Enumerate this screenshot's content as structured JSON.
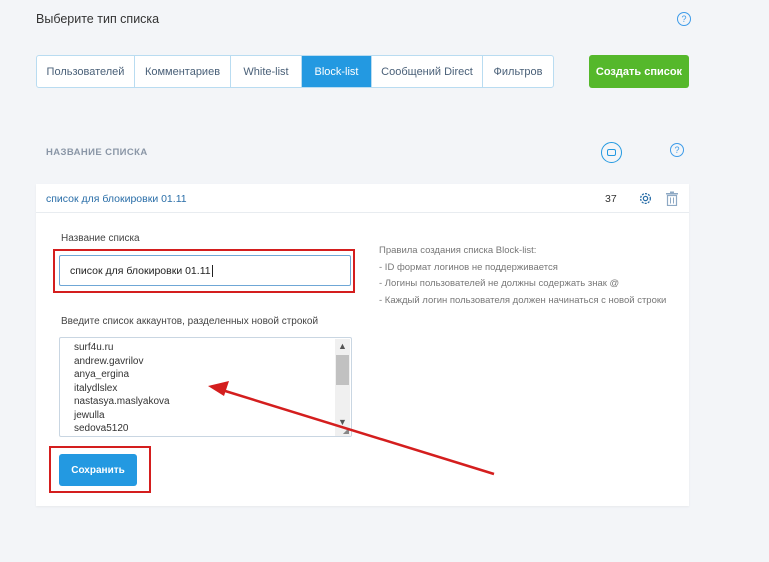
{
  "header": {
    "title": "Выберите тип списка"
  },
  "tabs": [
    {
      "label": "Пользователей",
      "active": false
    },
    {
      "label": "Комментариев",
      "active": false
    },
    {
      "label": "White-list",
      "active": false
    },
    {
      "label": "Block-list",
      "active": true
    },
    {
      "label": "Сообщений Direct",
      "active": false
    },
    {
      "label": "Фильтров",
      "active": false
    }
  ],
  "create_button": {
    "label": "Создать список"
  },
  "section": {
    "title": "НАЗВАНИЕ СПИСКА"
  },
  "list_row": {
    "name": "список для блокировки 01.11",
    "count": "37"
  },
  "form": {
    "name_label": "Название списка",
    "name_value": "список для блокировки 01.11",
    "accounts_label": "Введите список аккаунтов, разделенных новой строкой",
    "accounts": [
      "surf4u.ru",
      "andrew.gavrilov",
      "anya_ergina",
      "italydlslex",
      "nastasya.maslyakova",
      "jewulla",
      "sedova5120"
    ],
    "save_label": "Сохранить"
  },
  "rules": {
    "title": "Правила создания списка Block-list:",
    "items": [
      "- ID формат логинов не поддерживается",
      "- Логины пользователей не должны содержать знак @",
      "- Каждый логин пользователя должен начинаться с новой строки"
    ]
  },
  "colors": {
    "accent": "#2399e1",
    "create": "#55b82b",
    "annotation": "#d41e1e",
    "background": "#f3f5f8"
  }
}
